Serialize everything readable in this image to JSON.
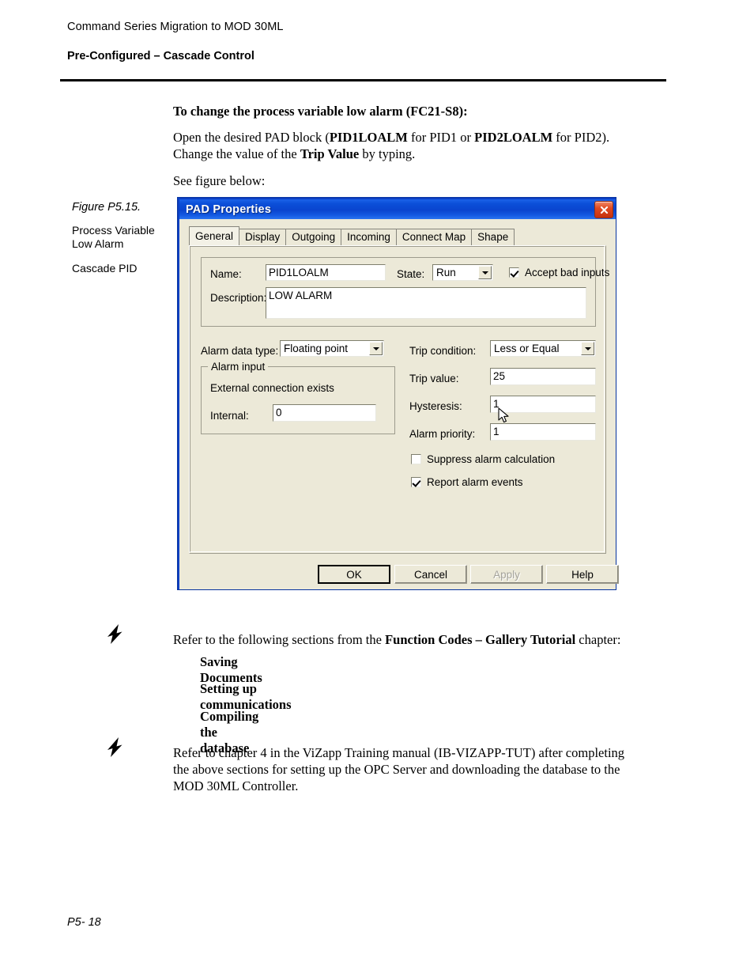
{
  "header": {
    "line1": "Command Series Migration to MOD 30ML",
    "line2": "Pre-Configured – Cascade Control"
  },
  "body": {
    "intro": "To change the process variable low alarm (FC21-S8):",
    "open_block_prefix": "Open the desired PAD block (",
    "open_block_pid1": "PID1LOALM",
    "open_block_mid": " for PID1 or ",
    "open_block_pid2": "PID2LOALM",
    "open_block_suffix": " for PID2).",
    "change_prefix": "Change the value of the ",
    "change_bold": "Trip Value",
    "change_suffix": " by typing.",
    "see_figure": "See figure below:"
  },
  "caption": {
    "title": "Figure P5.15.",
    "line1": "Process Variable Low Alarm",
    "line2": "Cascade PID"
  },
  "dialog": {
    "title": "PAD Properties",
    "close_icon": "close-icon",
    "tabs": [
      {
        "label": "General",
        "active": true
      },
      {
        "label": "Display",
        "active": false
      },
      {
        "label": "Outgoing",
        "active": false
      },
      {
        "label": "Incoming",
        "active": false
      },
      {
        "label": "Connect Map",
        "active": false
      },
      {
        "label": "Shape",
        "active": false
      }
    ],
    "fields": {
      "name_label": "Name:",
      "name_value": "PID1LOALM",
      "state_label": "State:",
      "state_value": "Run",
      "accept_bad_inputs_label": "Accept bad inputs",
      "accept_bad_inputs_checked": true,
      "description_label": "Description:",
      "description_value": "LOW  ALARM",
      "alarm_data_type_label": "Alarm data type:",
      "alarm_data_type_value": "Floating point",
      "alarm_input_group_label": "Alarm input",
      "external_connection_label": "External connection exists",
      "internal_label": "Internal:",
      "internal_value": "0",
      "trip_condition_label": "Trip condition:",
      "trip_condition_value": "Less or Equal",
      "trip_value_label": "Trip value:",
      "trip_value_value": "25",
      "hysteresis_label": "Hysteresis:",
      "hysteresis_value": "1",
      "alarm_priority_label": "Alarm priority:",
      "alarm_priority_value": "1",
      "suppress_alarm_label": "Suppress alarm calculation",
      "suppress_alarm_checked": false,
      "report_alarm_label": "Report alarm events",
      "report_alarm_checked": true
    },
    "buttons": {
      "ok": "OK",
      "cancel": "Cancel",
      "apply": "Apply",
      "help": "Help"
    },
    "colors": {
      "titlebar": "#0b4fd8",
      "face": "#ece9d8",
      "close": "#c5300f"
    }
  },
  "notes": {
    "note1_prefix": "Refer to the following sections from the ",
    "note1_bold": "Function Codes – Gallery Tutorial",
    "note1_suffix": " chapter:",
    "note1_items": [
      "Saving Documents",
      "Setting up communications",
      "Compiling the database"
    ],
    "note2_line1": "Refer to chapter 4 in the ViZapp Training manual (IB-VIZAPP-TUT) after completing",
    "note2_line2": "the above sections for setting up the OPC Server and downloading the database to the",
    "note2_line3": "MOD 30ML Controller."
  },
  "footer": {
    "page": "P5- 18"
  }
}
